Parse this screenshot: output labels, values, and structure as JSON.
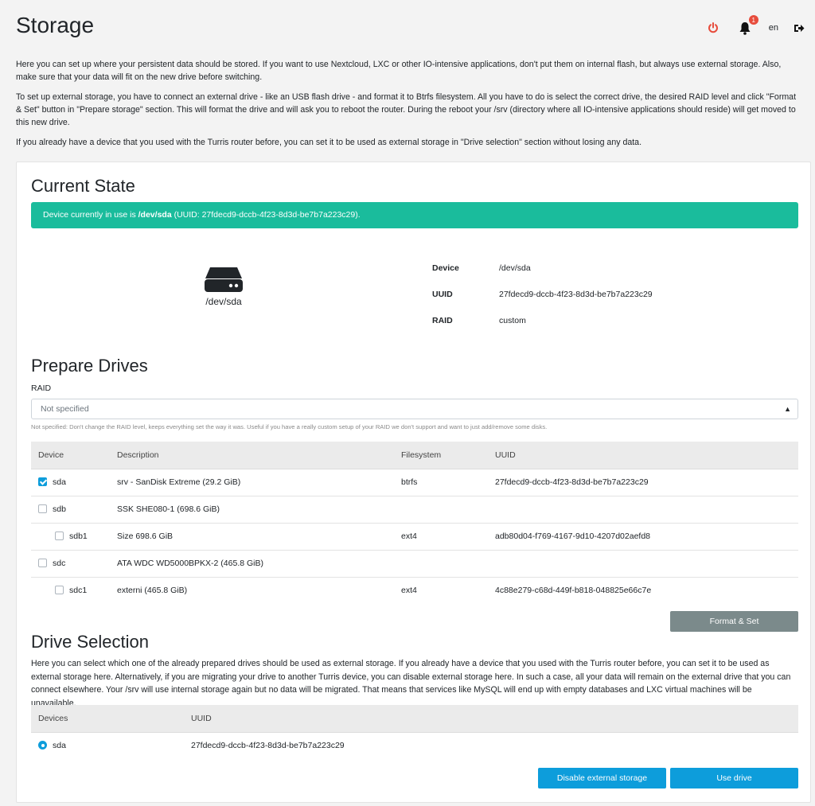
{
  "header": {
    "title": "Storage",
    "notification_count": "1",
    "language": "en"
  },
  "intro": {
    "p1": "Here you can set up where your persistent data should be stored. If you want to use Nextcloud, LXC or other IO-intensive applications, don't put them on internal flash, but always use external storage. Also, make sure that your data will fit on the new drive before switching.",
    "p2": "To set up external storage, you have to connect an external drive - like an USB flash drive - and format it to Btrfs filesystem. All you have to do is select the correct drive, the desired RAID level and click \"Format & Set\" button in \"Prepare storage\" section. This will format the drive and will ask you to reboot the router. During the reboot your /srv (directory where all IO-intensive applications should reside) will get moved to this new drive.",
    "p3": "If you already have a device that you used with the Turris router before, you can set it to be used as external storage in \"Drive selection\" section without losing any data."
  },
  "current_state": {
    "title": "Current State",
    "alert_prefix": "Device currently in use is ",
    "alert_device": "/dev/sda",
    "alert_suffix": " (UUID: 27fdecd9-dccb-4f23-8d3d-be7b7a223c29).",
    "drive_name": "/dev/sda",
    "info": [
      {
        "key": "Device",
        "value": "/dev/sda"
      },
      {
        "key": "UUID",
        "value": "27fdecd9-dccb-4f23-8d3d-be7b7a223c29"
      },
      {
        "key": "RAID",
        "value": "custom"
      }
    ]
  },
  "prepare": {
    "title": "Prepare Drives",
    "raid_label": "RAID",
    "raid_value": "Not specified",
    "raid_help": "Not specified: Don't change the RAID level, keeps everything set the way it was. Useful if you have a really custom setup of your RAID we don't support and want to just add/remove some disks.",
    "columns": [
      "Device",
      "Description",
      "Filesystem",
      "UUID"
    ],
    "rows": [
      {
        "device": "sda",
        "description": "srv - SanDisk Extreme (29.2 GiB)",
        "filesystem": "btrfs",
        "uuid": "27fdecd9-dccb-4f23-8d3d-be7b7a223c29"
      },
      {
        "device": "sdb",
        "description": "SSK SHE080-1 (698.6 GiB)",
        "filesystem": "",
        "uuid": ""
      },
      {
        "device": "sdb1",
        "description": "Size 698.6 GiB",
        "filesystem": "ext4",
        "uuid": "adb80d04-f769-4167-9d10-4207d02aefd8"
      },
      {
        "device": "sdc",
        "description": "ATA WDC WD5000BPKX-2 (465.8 GiB)",
        "filesystem": "",
        "uuid": ""
      },
      {
        "device": "sdc1",
        "description": "externi (465.8 GiB)",
        "filesystem": "ext4",
        "uuid": "4c88e279-c68d-449f-b818-048825e66c7e"
      }
    ],
    "format_button": "Format & Set"
  },
  "selection": {
    "title": "Drive Selection",
    "description": "Here you can select which one of the already prepared drives should be used as external storage. If you already have a device that you used with the Turris router before, you can set it to be used as external storage here. Alternatively, if you are migrating your drive to another Turris device, you can disable external storage here. In such a case, all your data will remain on the external drive that you can connect elsewhere. Your /srv will use internal storage again but no data will be migrated. That means that services like MySQL will end up with empty databases and LXC virtual machines will be unavailable.",
    "columns": [
      "Devices",
      "UUID"
    ],
    "rows": [
      {
        "device": "sda",
        "uuid": "27fdecd9-dccb-4f23-8d3d-be7b7a223c29"
      }
    ],
    "disable_button": "Disable external storage",
    "use_button": "Use drive"
  },
  "colors": {
    "accent": "#0d9ddb",
    "success": "#1abc9c",
    "danger": "#e74c3c",
    "secondary": "#7b8a8b"
  },
  "icons": [
    "power-icon",
    "bell-icon",
    "logout-icon",
    "hard-drive-icon"
  ]
}
